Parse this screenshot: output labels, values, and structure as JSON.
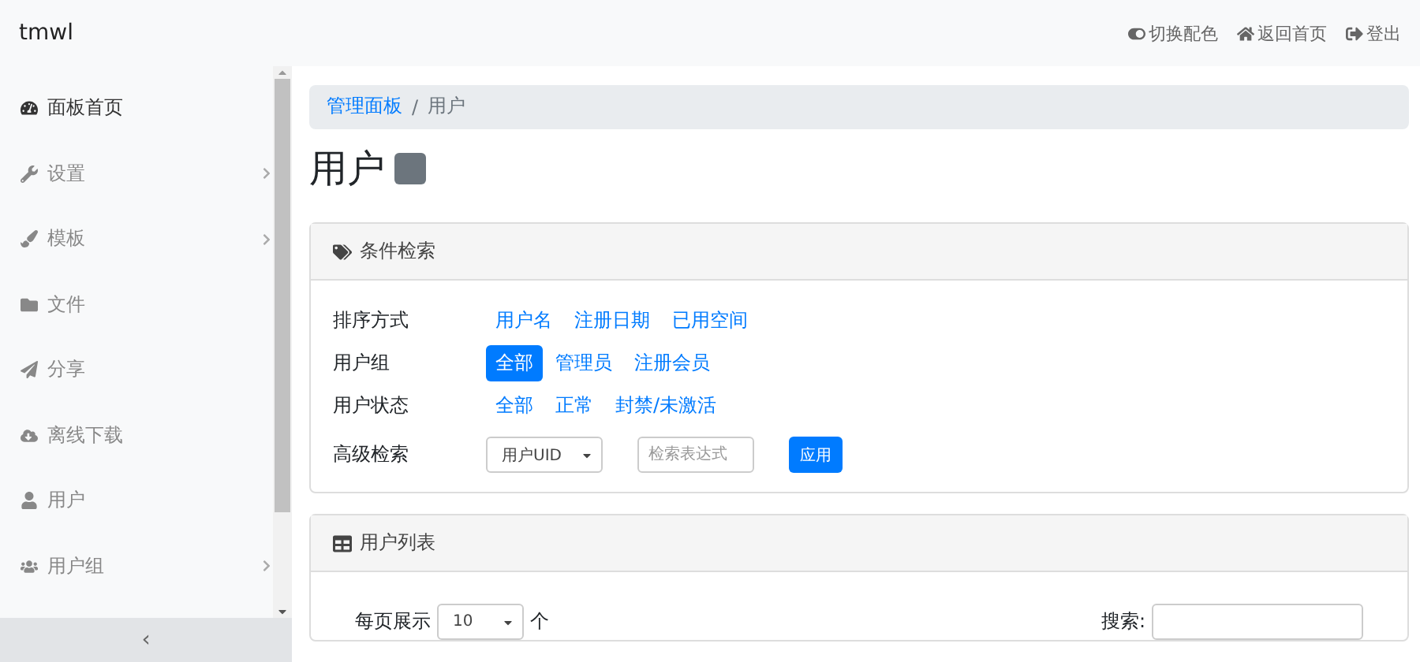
{
  "brand": "tmwl",
  "top_links": [
    {
      "label": "切换配色"
    },
    {
      "label": "返回首页"
    },
    {
      "label": "登出"
    }
  ],
  "sidebar": {
    "items": [
      {
        "label": "面板首页",
        "selected": true,
        "expandable": false
      },
      {
        "label": "设置",
        "selected": false,
        "expandable": true
      },
      {
        "label": "模板",
        "selected": false,
        "expandable": true
      },
      {
        "label": "文件",
        "selected": false,
        "expandable": false
      },
      {
        "label": "分享",
        "selected": false,
        "expandable": false
      },
      {
        "label": "离线下载",
        "selected": false,
        "expandable": false
      },
      {
        "label": "用户",
        "selected": false,
        "expandable": false
      },
      {
        "label": "用户组",
        "selected": false,
        "expandable": true
      }
    ],
    "collapse": "‹"
  },
  "breadcrumb_separator": "/",
  "breadcrumb": [
    {
      "label": "管理面板",
      "link": true
    },
    {
      "label": "用户",
      "link": false
    }
  ],
  "page_title": "用户",
  "filter_card": {
    "title": "条件检索",
    "rows": [
      {
        "kind": "links",
        "label": "排序方式",
        "options": [
          {
            "label": "用户名",
            "selected": false
          },
          {
            "label": "注册日期",
            "selected": false
          },
          {
            "label": "已用空间",
            "selected": false
          }
        ]
      },
      {
        "kind": "links",
        "label": "用户组",
        "options": [
          {
            "label": "全部",
            "selected": true
          },
          {
            "label": "管理员",
            "selected": false
          },
          {
            "label": "注册会员",
            "selected": false
          }
        ]
      },
      {
        "kind": "links",
        "label": "用户状态",
        "options": [
          {
            "label": "全部",
            "selected": false
          },
          {
            "label": "正常",
            "selected": false
          },
          {
            "label": "封禁/未激活",
            "selected": false
          }
        ]
      },
      {
        "kind": "form",
        "label": "高级检索",
        "select": "用户UID",
        "placeholder": "检索表达式",
        "button": "应用"
      }
    ]
  },
  "list_card": {
    "title": "用户列表",
    "page_size_label": "每页展示",
    "page_size": "10",
    "page_size_unit": "个",
    "search_label": "搜索:"
  }
}
